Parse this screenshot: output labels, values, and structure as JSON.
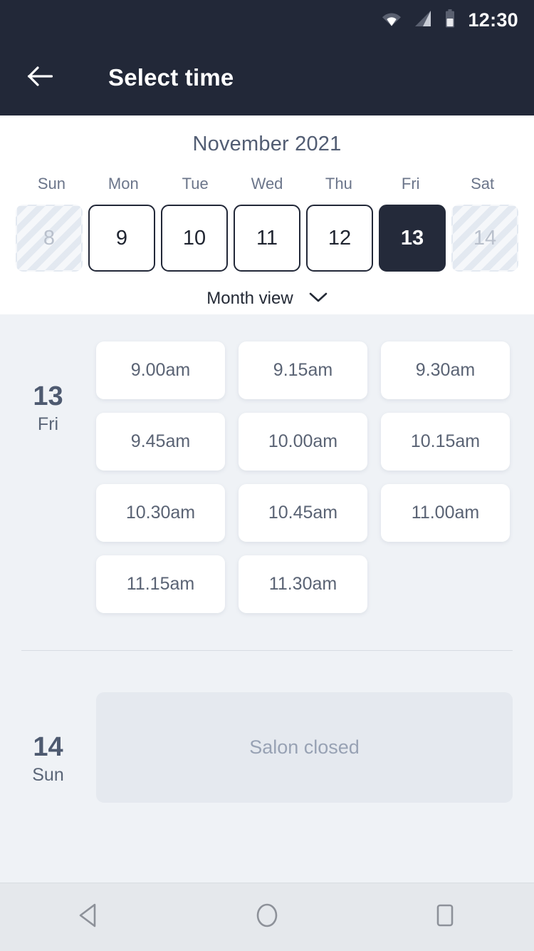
{
  "status_bar": {
    "time": "12:30",
    "icons": [
      "wifi-icon",
      "signal-icon",
      "battery-icon"
    ]
  },
  "app_bar": {
    "back_icon": "back-arrow-icon",
    "title": "Select time"
  },
  "calendar": {
    "month_label": "November 2021",
    "weekdays": [
      "Sun",
      "Mon",
      "Tue",
      "Wed",
      "Thu",
      "Fri",
      "Sat"
    ],
    "days": [
      {
        "num": "8",
        "state": "disabled"
      },
      {
        "num": "9",
        "state": "normal"
      },
      {
        "num": "10",
        "state": "normal"
      },
      {
        "num": "11",
        "state": "normal"
      },
      {
        "num": "12",
        "state": "normal"
      },
      {
        "num": "13",
        "state": "selected"
      },
      {
        "num": "14",
        "state": "disabled"
      }
    ],
    "month_view_label": "Month view",
    "month_view_icon": "chevron-down-icon"
  },
  "schedule": [
    {
      "day_num": "13",
      "day_name": "Fri",
      "slots": [
        "9.00am",
        "9.15am",
        "9.30am",
        "9.45am",
        "10.00am",
        "10.15am",
        "10.30am",
        "10.45am",
        "11.00am",
        "11.15am",
        "11.30am"
      ],
      "closed_text": null
    },
    {
      "day_num": "14",
      "day_name": "Sun",
      "slots": [],
      "closed_text": "Salon closed"
    }
  ],
  "nav_bar": {
    "back_icon": "nav-back-triangle-icon",
    "home_icon": "nav-home-circle-icon",
    "recents_icon": "nav-recents-square-icon"
  },
  "colors": {
    "header_bg": "#222838",
    "selected_day_bg": "#242a3a",
    "page_bg": "#eff2f6",
    "card_bg": "#ffffff",
    "muted_text": "#98a2b4",
    "slate_text": "#525d73",
    "nav_bg": "#e5e8ec"
  }
}
